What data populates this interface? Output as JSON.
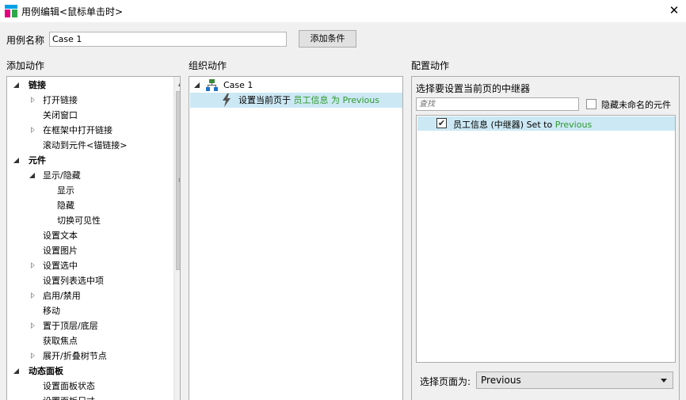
{
  "window": {
    "title": "用例编辑<鼠标单击时>",
    "close_glyph": "✕"
  },
  "case_name": {
    "label": "用例名称",
    "value": "Case 1"
  },
  "add_condition_label": "添加条件",
  "sections": {
    "add_action": "添加动作",
    "organize_actions": "组织动作",
    "configure_action": "配置动作"
  },
  "action_tree": [
    {
      "label": "链接",
      "indent": 0,
      "expander": "open",
      "bold": true
    },
    {
      "label": "打开链接",
      "indent": 1,
      "expander": "closed",
      "bold": false
    },
    {
      "label": "关闭窗口",
      "indent": 1,
      "expander": "none",
      "bold": false
    },
    {
      "label": "在框架中打开链接",
      "indent": 1,
      "expander": "closed",
      "bold": false
    },
    {
      "label": "滚动到元件<锚链接>",
      "indent": 1,
      "expander": "none",
      "bold": false
    },
    {
      "label": "元件",
      "indent": 0,
      "expander": "open",
      "bold": true
    },
    {
      "label": "显示/隐藏",
      "indent": 1,
      "expander": "open",
      "bold": false
    },
    {
      "label": "显示",
      "indent": 2,
      "expander": "none",
      "bold": false
    },
    {
      "label": "隐藏",
      "indent": 2,
      "expander": "none",
      "bold": false
    },
    {
      "label": "切换可见性",
      "indent": 2,
      "expander": "none",
      "bold": false
    },
    {
      "label": "设置文本",
      "indent": 1,
      "expander": "none",
      "bold": false
    },
    {
      "label": "设置图片",
      "indent": 1,
      "expander": "none",
      "bold": false
    },
    {
      "label": "设置选中",
      "indent": 1,
      "expander": "closed",
      "bold": false
    },
    {
      "label": "设置列表选中项",
      "indent": 1,
      "expander": "none",
      "bold": false
    },
    {
      "label": "启用/禁用",
      "indent": 1,
      "expander": "closed",
      "bold": false
    },
    {
      "label": "移动",
      "indent": 1,
      "expander": "none",
      "bold": false
    },
    {
      "label": "置于顶层/底层",
      "indent": 1,
      "expander": "closed",
      "bold": false
    },
    {
      "label": "获取焦点",
      "indent": 1,
      "expander": "none",
      "bold": false
    },
    {
      "label": "展开/折叠树节点",
      "indent": 1,
      "expander": "closed",
      "bold": false
    },
    {
      "label": "动态面板",
      "indent": 0,
      "expander": "open",
      "bold": true
    },
    {
      "label": "设置面板状态",
      "indent": 1,
      "expander": "none",
      "bold": false
    },
    {
      "label": "设置面板尺寸",
      "indent": 1,
      "expander": "none",
      "bold": false
    }
  ],
  "organize": {
    "case_label": "Case 1",
    "action_prefix": "设置当前页于",
    "action_target": "员工信息 为 Previous",
    "colors": {
      "selected_row": "#cce8f4",
      "target_text": "#2e9a2e",
      "case_icon": "#3a8a3a"
    }
  },
  "config": {
    "heading": "选择要设置当前页的中继器",
    "search_placeholder": "查找",
    "hide_unnamed_label": "隐藏未命名的元件",
    "hide_unnamed_checked": false,
    "repeater_row": {
      "name": "员工信息 (中继器) Set to ",
      "value": "Previous",
      "checked": true
    },
    "page_label": "选择页面为:",
    "page_value": "Previous"
  },
  "app_icon_colors": [
    "#e4007f",
    "#00a0e9",
    "#2ea84b"
  ]
}
